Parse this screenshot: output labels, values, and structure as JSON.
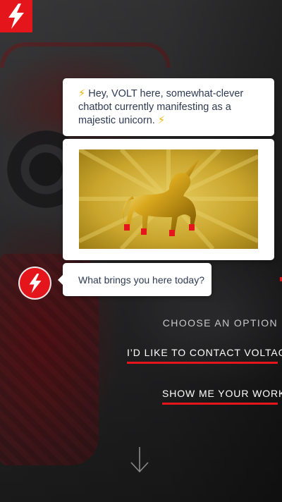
{
  "chat": {
    "intro_text": "Hey, VOLT here, somewhat-clever chatbot currently manifesting as a majestic unicorn.",
    "question_text": "What brings you here today?"
  },
  "options": {
    "prompt": "CHOOSE AN OPTION",
    "contact": "I’D LIKE TO CONTACT VOLTAGE",
    "work": "SHOW ME YOUR WORK."
  },
  "icons": {
    "logo": "lightning-bolt-icon",
    "avatar": "lightning-bolt-icon",
    "emoji": "high-voltage-emoji",
    "scroll": "arrow-down-icon"
  },
  "colors": {
    "brand_red": "#e4151b",
    "bubble_bg": "#ffffff",
    "text": "#2d3a52",
    "emoji_yellow": "#f2b500"
  }
}
